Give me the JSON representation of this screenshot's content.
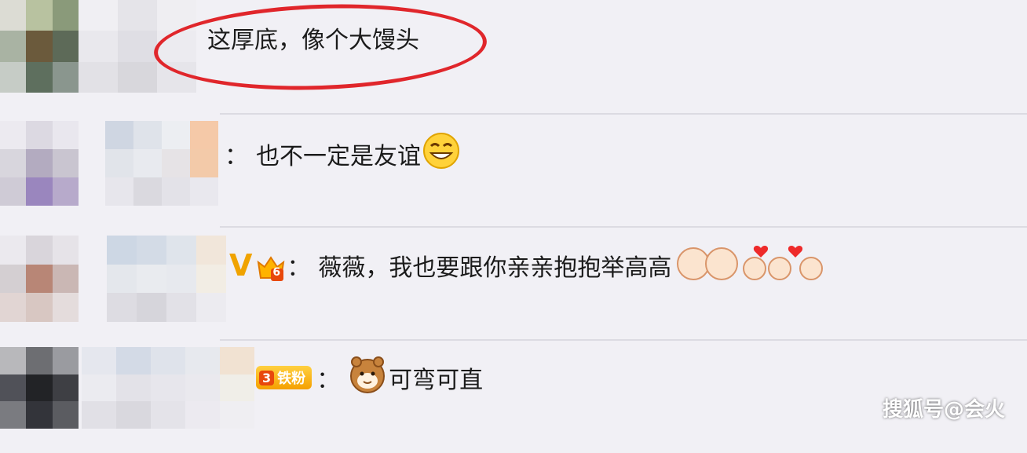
{
  "comments": [
    {
      "text": "这厚底，像个大馒头"
    },
    {
      "colon": "：",
      "text": "也不一定是友谊"
    },
    {
      "vip_letter": "V",
      "crown_level": "6",
      "colon": "：",
      "text": "薇薇，我也要跟你亲亲抱抱举高高"
    },
    {
      "fan_level": "3",
      "fan_label": "铁粉",
      "colon": "：",
      "text": "可弯可直"
    }
  ],
  "watermark": "搜狐号@会火",
  "colors": {
    "circle": "#e0262b",
    "vip": "#f0a300",
    "background": "#f1f0f5"
  }
}
